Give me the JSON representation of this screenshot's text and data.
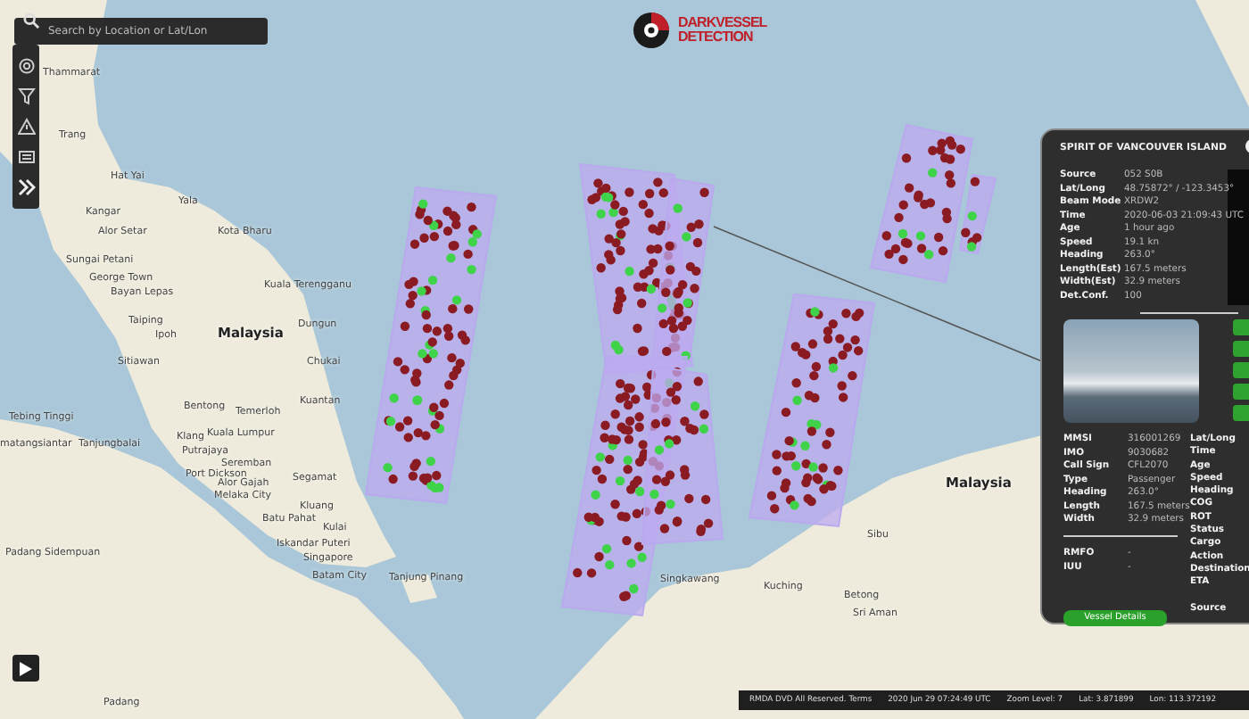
{
  "search": {
    "placeholder": "Search by Location or Lat/Lon"
  },
  "logo": {
    "line_1": "DARKVESSEL",
    "line_2": "DETECTION"
  },
  "map_labels": [
    {
      "text": "Thammarat",
      "kind": "city"
    },
    {
      "text": "Trang",
      "kind": "city"
    },
    {
      "text": "Hat Yai",
      "kind": "city"
    },
    {
      "text": "Kangar",
      "kind": "city"
    },
    {
      "text": "Alor Setar",
      "kind": "city"
    },
    {
      "text": "Yala",
      "kind": "city"
    },
    {
      "text": "Kota Bharu",
      "kind": "city"
    },
    {
      "text": "Sungai Petani",
      "kind": "city"
    },
    {
      "text": "George Town",
      "kind": "city"
    },
    {
      "text": "Bayan Lepas",
      "kind": "city"
    },
    {
      "text": "Taiping",
      "kind": "city"
    },
    {
      "text": "Ipoh",
      "kind": "city"
    },
    {
      "text": "Malaysia",
      "kind": "country"
    },
    {
      "text": "Kuala Terengganu",
      "kind": "city"
    },
    {
      "text": "Dungun",
      "kind": "city"
    },
    {
      "text": "Chukai",
      "kind": "city"
    },
    {
      "text": "Kuantan",
      "kind": "city"
    },
    {
      "text": "Sitiawan",
      "kind": "city"
    },
    {
      "text": "Bentong",
      "kind": "city"
    },
    {
      "text": "Temerloh",
      "kind": "city"
    },
    {
      "text": "Klang",
      "kind": "city"
    },
    {
      "text": "Kuala Lumpur",
      "kind": "city"
    },
    {
      "text": "Putrajaya",
      "kind": "city"
    },
    {
      "text": "Seremban",
      "kind": "city"
    },
    {
      "text": "Port Dickson",
      "kind": "city"
    },
    {
      "text": "Alor Gajah",
      "kind": "city"
    },
    {
      "text": "Melaka City",
      "kind": "city"
    },
    {
      "text": "Segamat",
      "kind": "city"
    },
    {
      "text": "Kluang",
      "kind": "city"
    },
    {
      "text": "Batu Pahat",
      "kind": "city"
    },
    {
      "text": "Kulai",
      "kind": "city"
    },
    {
      "text": "Iskandar Puteri",
      "kind": "city"
    },
    {
      "text": "Singapore",
      "kind": "city"
    },
    {
      "text": "Batam City",
      "kind": "city"
    },
    {
      "text": "Tebing Tinggi",
      "kind": "city"
    },
    {
      "text": "matangsiantar",
      "kind": "city"
    },
    {
      "text": "Tanjungbalai",
      "kind": "city"
    },
    {
      "text": "Padang Sidempuan",
      "kind": "city"
    },
    {
      "text": "Padang",
      "kind": "city"
    },
    {
      "text": "Tanjung Pinang",
      "kind": "city"
    },
    {
      "text": "Singkawang",
      "kind": "city"
    },
    {
      "text": "Kuching",
      "kind": "city"
    },
    {
      "text": "Sibu",
      "kind": "city"
    },
    {
      "text": "Betong",
      "kind": "city"
    },
    {
      "text": "Sri Aman",
      "kind": "city"
    },
    {
      "text": "Malaysia",
      "kind": "country"
    }
  ],
  "vessel_panel": {
    "title": "SPIRIT OF VANCOUVER ISLAND",
    "detection_fields": [
      {
        "label": "Source",
        "value": "052 S0B"
      },
      {
        "label": "Lat/Long",
        "value": "48.75872° / -123.3453°"
      },
      {
        "label": "Beam Mode",
        "value": "XRDW2"
      },
      {
        "label": "Time",
        "value": "2020-06-03 21:09:43 UTC"
      },
      {
        "label": "Age",
        "value": "1 hour ago"
      },
      {
        "label": "Speed",
        "value": "19.1 kn"
      },
      {
        "label": "Heading",
        "value": "263.0°"
      },
      {
        "label": "Length(Est)",
        "value": "167.5 meters"
      },
      {
        "label": "Width(Est)",
        "value": "32.9 meters"
      },
      {
        "label": "Det.Conf.",
        "value": "100"
      }
    ],
    "ais_fields": [
      {
        "label": "MMSI",
        "value": "316001269"
      },
      {
        "label": "IMO",
        "value": "9030682"
      },
      {
        "label": "Call Sign",
        "value": "CFL2070"
      },
      {
        "label": "Type",
        "value": "Passenger"
      },
      {
        "label": "Heading",
        "value": "263.0°"
      },
      {
        "label": "Length",
        "value": "167.5 meters"
      },
      {
        "label": "Width",
        "value": "32.9 meters"
      }
    ],
    "risk_fields": [
      {
        "label": "RMFO",
        "value": "-"
      },
      {
        "label": "IUU",
        "value": "-"
      }
    ],
    "track_labels": [
      "Lat/Long",
      "Time",
      "Age",
      "Speed",
      "Heading",
      "COG",
      "ROT",
      "Status",
      "Cargo",
      "Action",
      "Destination",
      "ETA"
    ],
    "source_label": "Source",
    "details_button": "Vessel Details"
  },
  "status_bar": {
    "copyright": "RMDA DVD All Reserved. Terms",
    "time": "2020 Jun 29 07:24:49 UTC",
    "zoom": "Zoom Level: 7",
    "lat": "Lat: 3.871899",
    "lon": "Lon: 113.372192"
  }
}
